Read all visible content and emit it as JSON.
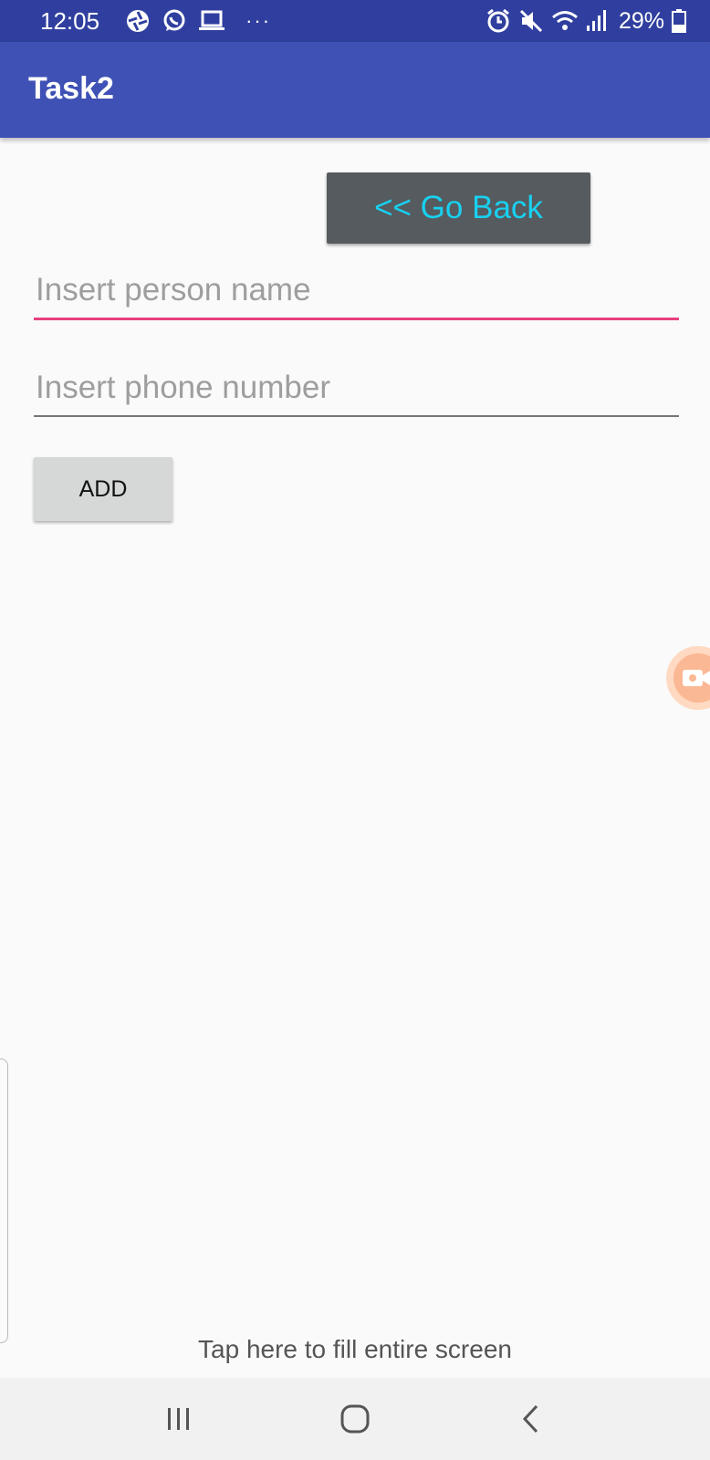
{
  "status_bar": {
    "time": "12:05",
    "more_glyph": "···",
    "battery_text": "29%",
    "icons": [
      "aperture-icon",
      "whatsapp-icon",
      "laptop-icon",
      "alarm-icon",
      "mute-icon",
      "wifi-icon",
      "signal-icon",
      "battery-icon"
    ]
  },
  "app_bar": {
    "title": "Task2"
  },
  "main": {
    "go_back_label": "<< Go Back",
    "name_placeholder": "Insert person name",
    "phone_placeholder": "Insert phone number",
    "add_label": "ADD"
  },
  "overlay": {
    "fill_hint": "Tap here to fill entire screen"
  },
  "colors": {
    "status_bar": "#303f9f",
    "app_bar": "#3f51b5",
    "accent": "#e8417f",
    "go_back_text": "#18d1f0",
    "go_back_bg": "#555b5f"
  }
}
